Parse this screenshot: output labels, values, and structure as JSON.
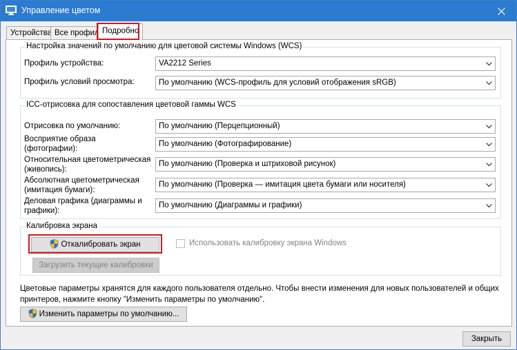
{
  "window": {
    "title": "Управление цветом"
  },
  "tabs": [
    {
      "label": "Устройства"
    },
    {
      "label": "Все профили"
    },
    {
      "label": "Подробно"
    }
  ],
  "wcs_defaults": {
    "legend": "Настройка значений по умолчанию для цветовой системы Windows (WCS)",
    "device_profile": {
      "label": "Профиль устройства:",
      "value": "VA2212 Series"
    },
    "viewing_profile": {
      "label": "Профиль условий просмотра:",
      "value": "По умолчанию (WCS-профиль для условий отображения sRGB)"
    }
  },
  "icc_rendering": {
    "legend": "ICC-отрисовка для сопоставления цветовой гаммы WCS",
    "rows": [
      {
        "label": "Отрисовка по умолчанию:",
        "value": "По умолчанию (Перцепционный)"
      },
      {
        "label_line1": "Восприятие образа",
        "label_line2": "(фотографии):",
        "value": "По умолчанию (Фотографирование)"
      },
      {
        "label_line1": "Относительная цветометрическая",
        "label_line2": "(живопись):",
        "value": "По умолчанию (Проверка и штриховой рисунок)"
      },
      {
        "label_line1": "Абсолютная цветометрическая",
        "label_line2": "(имитация бумаги):",
        "value": "По умолчанию (Проверка — имитация цвета бумаги или носителя)"
      },
      {
        "label_line1": "Деловая графика (диаграммы и",
        "label_line2": "графики):",
        "value": "По умолчанию (Диаграммы и графики)"
      }
    ]
  },
  "calibration": {
    "legend": "Калибровка экрана",
    "calibrate_button": "Откалибровать экран",
    "use_windows_calibration": "Использовать калибровку экрана Windows",
    "load_calibrations_button": "Загрузить текущие калибровки"
  },
  "info_text_line1": "Цветовые параметры хранятся для каждого пользователя отдельно. Чтобы внести изменения для новых пользователей и общих",
  "info_text_line2": "принтеров, нажмите кнопку \"Изменить параметры по умолчанию\".",
  "change_defaults_button": "Изменить параметры по умолчанию...",
  "close_button": "Закрыть",
  "colors": {
    "titlebar": "#2b7bd0",
    "highlight": "#d6151a"
  },
  "icons": [
    "monitor-icon",
    "close-icon",
    "chevron-down-icon",
    "uac-shield-icon"
  ]
}
